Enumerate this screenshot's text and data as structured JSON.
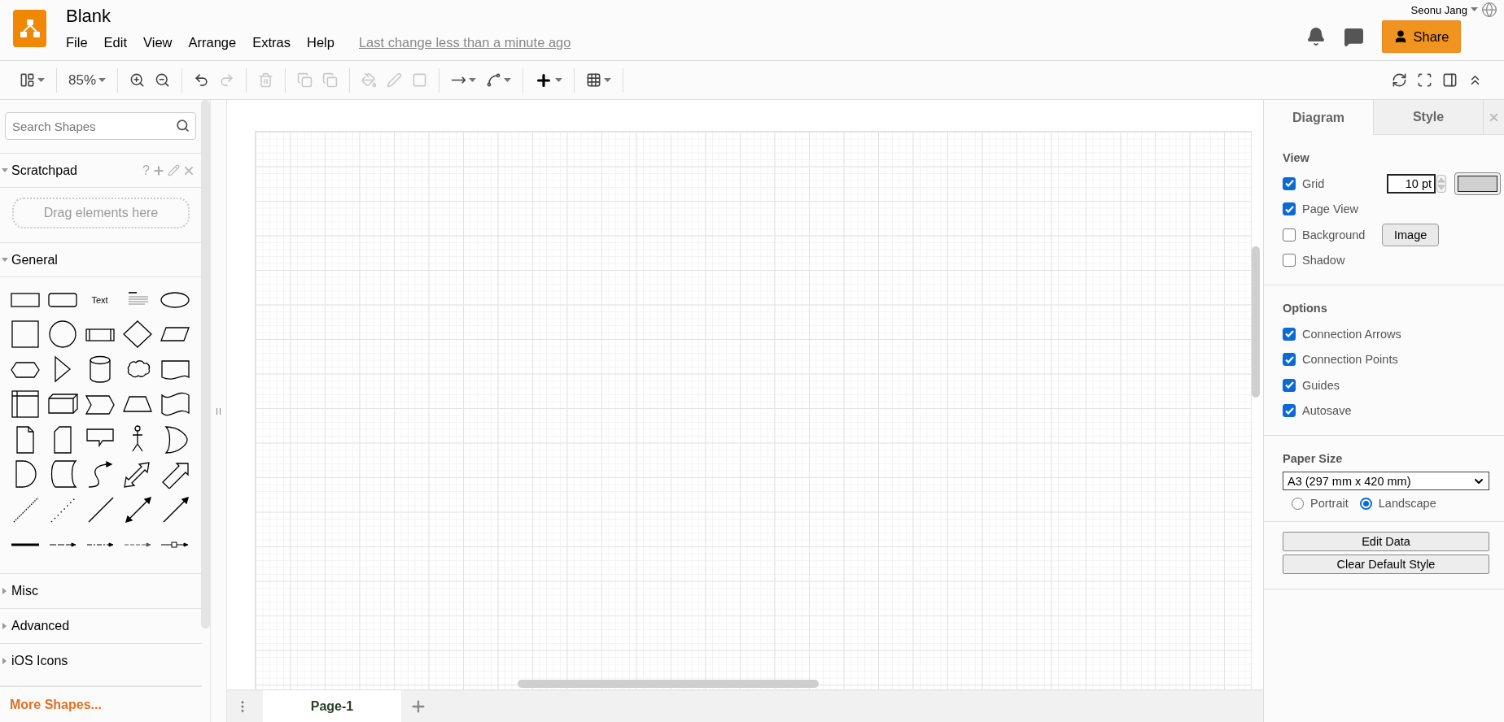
{
  "header": {
    "title": "Blank",
    "menu": [
      "File",
      "Edit",
      "View",
      "Arrange",
      "Extras",
      "Help"
    ],
    "last_change": "Last change less than a minute ago",
    "user": "Seonu Jang",
    "share": "Share"
  },
  "toolbar": {
    "groups": [
      [
        {
          "kind": "format",
          "dropdown": true,
          "disabled": false
        }
      ],
      [
        {
          "kind": "zoom",
          "label": "85%",
          "dropdown": true,
          "disabled": false
        }
      ],
      [
        {
          "kind": "zoom-in",
          "disabled": false
        },
        {
          "kind": "zoom-out",
          "disabled": false
        }
      ],
      [
        {
          "kind": "undo",
          "disabled": false
        },
        {
          "kind": "redo",
          "disabled": true
        }
      ],
      [
        {
          "kind": "delete",
          "disabled": true
        }
      ],
      [
        {
          "kind": "to-front",
          "disabled": true
        },
        {
          "kind": "to-back",
          "disabled": true
        }
      ],
      [
        {
          "kind": "fill",
          "disabled": true
        },
        {
          "kind": "line",
          "disabled": true
        },
        {
          "kind": "shadow",
          "disabled": true
        }
      ],
      [
        {
          "kind": "connection",
          "dropdown": true,
          "disabled": false
        },
        {
          "kind": "waypoints",
          "dropdown": true,
          "disabled": false
        }
      ],
      [
        {
          "kind": "insert",
          "dropdown": true,
          "disabled": false
        }
      ],
      [
        {
          "kind": "table",
          "dropdown": true,
          "disabled": false
        }
      ]
    ],
    "right": [
      {
        "kind": "sync",
        "disabled": false
      },
      {
        "kind": "fullscreen",
        "disabled": false
      },
      {
        "kind": "panel",
        "disabled": false
      },
      {
        "kind": "collapse",
        "disabled": false
      }
    ]
  },
  "sidebar": {
    "search": {
      "placeholder": "Search Shapes"
    },
    "sections": [
      {
        "kind": "scratchpad",
        "title": "Scratchpad",
        "expanded": true,
        "help": "?",
        "hint": "Drag elements here"
      },
      {
        "kind": "shapes",
        "title": "General",
        "expanded": true,
        "shapes": [
          {
            "kind": "rect"
          },
          {
            "kind": "rounded"
          },
          {
            "kind": "text",
            "label": "Text"
          },
          {
            "kind": "heading"
          },
          {
            "kind": "ellipse"
          },
          {
            "kind": "square"
          },
          {
            "kind": "circle"
          },
          {
            "kind": "process"
          },
          {
            "kind": "diamond"
          },
          {
            "kind": "parallelogram"
          },
          {
            "kind": "hexagon"
          },
          {
            "kind": "triangle"
          },
          {
            "kind": "cylinder"
          },
          {
            "kind": "cloud"
          },
          {
            "kind": "document"
          },
          {
            "kind": "storage"
          },
          {
            "kind": "cube"
          },
          {
            "kind": "step"
          },
          {
            "kind": "trapezoid"
          },
          {
            "kind": "tape"
          },
          {
            "kind": "note"
          },
          {
            "kind": "card"
          },
          {
            "kind": "callout"
          },
          {
            "kind": "actor"
          },
          {
            "kind": "or"
          },
          {
            "kind": "delay"
          },
          {
            "kind": "data-storage"
          },
          {
            "kind": "curve-arrow"
          },
          {
            "kind": "double-block-arrow"
          },
          {
            "kind": "block-arrow"
          },
          {
            "kind": "dotted-line"
          },
          {
            "kind": "sparse-line"
          },
          {
            "kind": "line"
          },
          {
            "kind": "double-arrow"
          },
          {
            "kind": "arrow"
          },
          {
            "kind": "thick-line"
          },
          {
            "kind": "dash-arrow"
          },
          {
            "kind": "long-dash-arrow"
          },
          {
            "kind": "light-arrow"
          },
          {
            "kind": "box-arrow"
          }
        ]
      },
      {
        "kind": "shapes",
        "title": "Misc",
        "expanded": false
      },
      {
        "kind": "shapes",
        "title": "Advanced",
        "expanded": false
      },
      {
        "kind": "shapes",
        "title": "iOS Icons",
        "expanded": false
      }
    ],
    "more": "More Shapes..."
  },
  "pages": [
    {
      "label": "Page-1",
      "selected": true
    }
  ],
  "format_panel": {
    "tabs": [
      {
        "label": "Diagram",
        "selected": true
      },
      {
        "label": "Style",
        "selected": false
      }
    ],
    "view": {
      "title": "View",
      "rows": [
        {
          "kind": "grid",
          "label": "Grid",
          "checked": true,
          "value": "10 pt"
        },
        {
          "kind": "plain",
          "label": "Page View",
          "checked": true
        },
        {
          "kind": "button",
          "label": "Background",
          "checked": false,
          "button": "Image"
        },
        {
          "kind": "plain",
          "label": "Shadow",
          "checked": false
        }
      ]
    },
    "options": {
      "title": "Options",
      "rows": [
        {
          "kind": "plain",
          "label": "Connection Arrows",
          "checked": true
        },
        {
          "kind": "plain",
          "label": "Connection Points",
          "checked": true
        },
        {
          "kind": "plain",
          "label": "Guides",
          "checked": true
        },
        {
          "kind": "plain",
          "label": "Autosave",
          "checked": true
        }
      ]
    },
    "paper": {
      "title": "Paper Size",
      "value": "A3 (297 mm x 420 mm)",
      "orientations": [
        {
          "label": "Portrait",
          "selected": false
        },
        {
          "label": "Landscape",
          "selected": true
        }
      ]
    },
    "buttons": [
      "Edit Data",
      "Clear Default Style"
    ]
  }
}
